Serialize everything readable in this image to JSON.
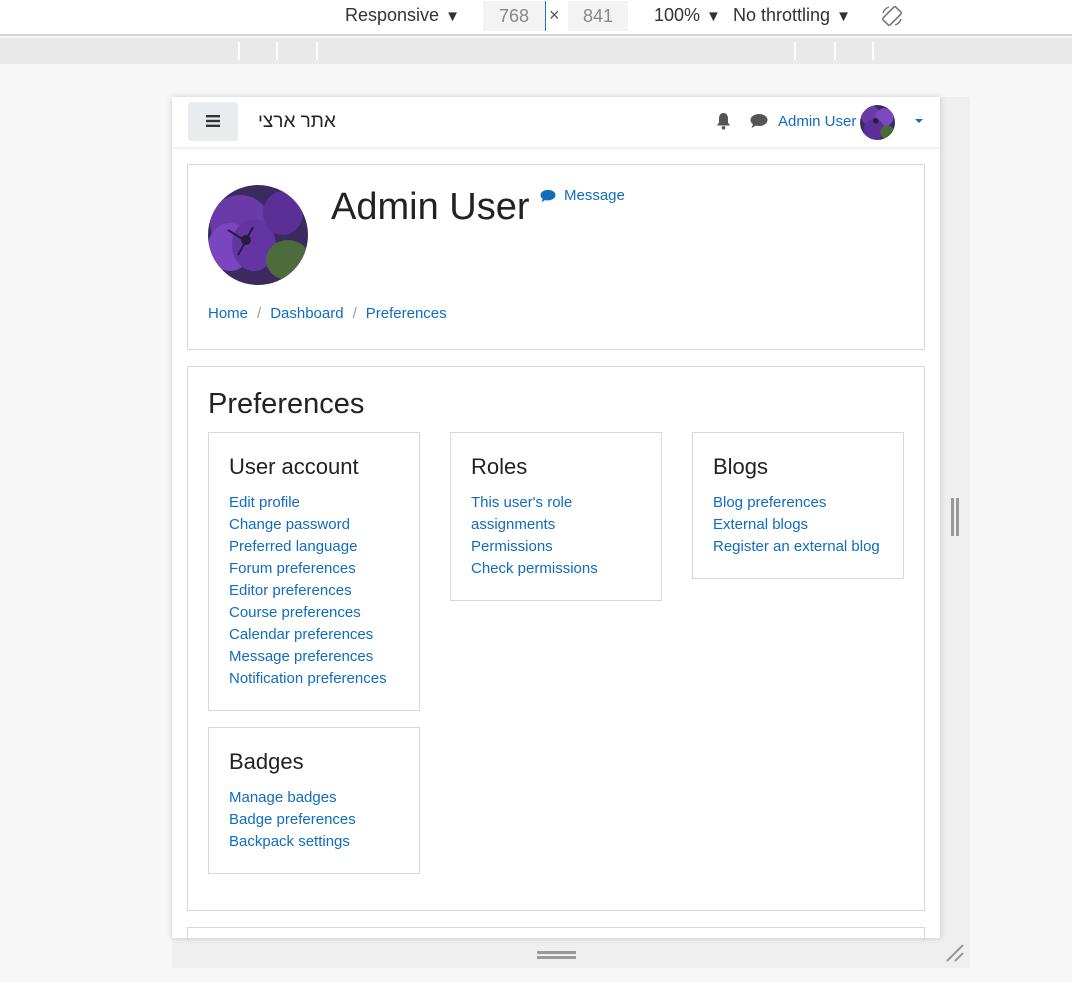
{
  "devtools": {
    "device": "Responsive",
    "width": "768",
    "height": "841",
    "times": "×",
    "zoom": "100%",
    "throttling": "No throttling",
    "caret": "▼"
  },
  "navbar": {
    "site_name": "אתר ארצי",
    "user_name": "Admin User"
  },
  "header": {
    "title": "Admin User",
    "message_label": "Message",
    "breadcrumb": [
      "Home",
      "Dashboard",
      "Preferences"
    ],
    "separator": "/"
  },
  "main": {
    "title": "Preferences",
    "sections": {
      "user_account": {
        "title": "User account",
        "links": [
          "Edit profile",
          "Change password",
          "Preferred language",
          "Forum preferences",
          "Editor preferences",
          "Course preferences",
          "Calendar preferences",
          "Message preferences",
          "Notification preferences"
        ]
      },
      "roles": {
        "title": "Roles",
        "links": [
          "This user's role assignments",
          "Permissions",
          "Check permissions"
        ]
      },
      "blogs": {
        "title": "Blogs",
        "links": [
          "Blog preferences",
          "External blogs",
          "Register an external blog"
        ]
      },
      "badges": {
        "title": "Badges",
        "links": [
          "Manage badges",
          "Badge preferences",
          "Backpack settings"
        ]
      }
    }
  },
  "colors": {
    "link": "#0f6cbf",
    "text": "#222222",
    "border": "#d8d8d8"
  },
  "icons": [
    "hamburger-icon",
    "bell-icon",
    "chat-icon",
    "rotate-icon",
    "resize-corner-icon"
  ]
}
